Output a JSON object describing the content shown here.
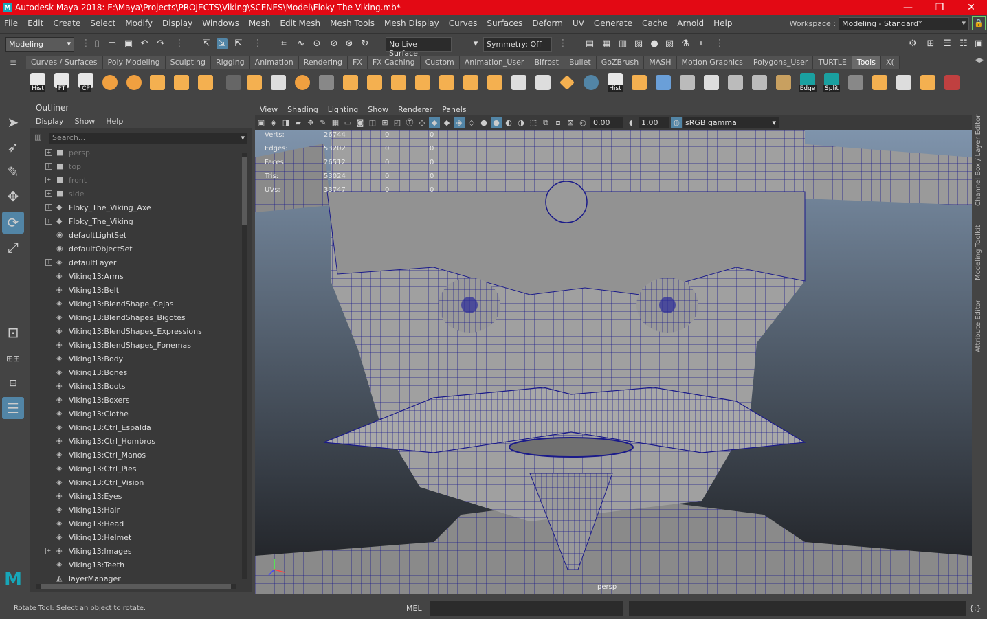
{
  "window": {
    "title": "Autodesk Maya 2018: E:\\Maya\\Projects\\PROJECTS\\Viking\\SCENES\\Model\\Floky The Viking.mb*",
    "logo_letter": "M"
  },
  "menubar": [
    "File",
    "Edit",
    "Create",
    "Select",
    "Modify",
    "Display",
    "Windows",
    "Mesh",
    "Edit Mesh",
    "Mesh Tools",
    "Mesh Display",
    "Curves",
    "Surfaces",
    "Deform",
    "UV",
    "Generate",
    "Cache",
    "Arnold",
    "Help"
  ],
  "workspace": {
    "label": "Workspace :",
    "value": "Modeling - Standard*"
  },
  "statusline": {
    "mode": "Modeling",
    "live_surface": "No Live Surface",
    "symmetry": "Symmetry: Off"
  },
  "shelf_tabs": [
    "Curves / Surfaces",
    "Poly Modeling",
    "Sculpting",
    "Rigging",
    "Animation",
    "Rendering",
    "FX",
    "FX Caching",
    "Custom",
    "Animation_User",
    "Bifrost",
    "Bullet",
    "GoZBrush",
    "MASH",
    "Motion Graphics",
    "Polygons_User",
    "TURTLE",
    "Tools",
    "X("
  ],
  "shelf_active": "Tools",
  "shelf_labels": {
    "hist": "Hist",
    "ft": "FT",
    "cp": "CP",
    "hist2": "Hist",
    "edge": "Edge",
    "split": "Split"
  },
  "outliner": {
    "title": "Outliner",
    "menu": [
      "Display",
      "Show",
      "Help"
    ],
    "search_placeholder": "Search...",
    "items": [
      {
        "label": "persp",
        "icon": "camera-icon",
        "expand": true,
        "dim": true
      },
      {
        "label": "top",
        "icon": "camera-icon",
        "expand": true,
        "dim": true
      },
      {
        "label": "front",
        "icon": "camera-icon",
        "expand": true,
        "dim": true
      },
      {
        "label": "side",
        "icon": "camera-icon",
        "expand": true,
        "dim": true
      },
      {
        "label": "Floky_The_Viking_Axe",
        "icon": "transform-icon",
        "expand": true,
        "dim": false
      },
      {
        "label": "Floky_The_Viking",
        "icon": "transform-icon",
        "expand": true,
        "dim": false
      },
      {
        "label": "defaultLightSet",
        "icon": "set-icon",
        "expand": false,
        "dim": false
      },
      {
        "label": "defaultObjectSet",
        "icon": "set-icon",
        "expand": false,
        "dim": false
      },
      {
        "label": "defaultLayer",
        "icon": "layer-icon",
        "expand": true,
        "dim": false
      },
      {
        "label": "Viking13:Arms",
        "icon": "layer-icon",
        "expand": false,
        "dim": false
      },
      {
        "label": "Viking13:Belt",
        "icon": "layer-icon",
        "expand": false,
        "dim": false
      },
      {
        "label": "Viking13:BlendShape_Cejas",
        "icon": "layer-icon",
        "expand": false,
        "dim": false
      },
      {
        "label": "Viking13:BlendShapes_Bigotes",
        "icon": "layer-icon",
        "expand": false,
        "dim": false
      },
      {
        "label": "Viking13:BlendShapes_Expressions",
        "icon": "layer-icon",
        "expand": false,
        "dim": false
      },
      {
        "label": "Viking13:BlendShapes_Fonemas",
        "icon": "layer-icon",
        "expand": false,
        "dim": false
      },
      {
        "label": "Viking13:Body",
        "icon": "layer-icon",
        "expand": false,
        "dim": false
      },
      {
        "label": "Viking13:Bones",
        "icon": "layer-icon",
        "expand": false,
        "dim": false
      },
      {
        "label": "Viking13:Boots",
        "icon": "layer-icon",
        "expand": false,
        "dim": false
      },
      {
        "label": "Viking13:Boxers",
        "icon": "layer-icon",
        "expand": false,
        "dim": false
      },
      {
        "label": "Viking13:Clothe",
        "icon": "layer-icon",
        "expand": false,
        "dim": false
      },
      {
        "label": "Viking13:Ctrl_Espalda",
        "icon": "layer-icon",
        "expand": false,
        "dim": false
      },
      {
        "label": "Viking13:Ctrl_Hombros",
        "icon": "layer-icon",
        "expand": false,
        "dim": false
      },
      {
        "label": "Viking13:Ctrl_Manos",
        "icon": "layer-icon",
        "expand": false,
        "dim": false
      },
      {
        "label": "Viking13:Ctrl_Pies",
        "icon": "layer-icon",
        "expand": false,
        "dim": false
      },
      {
        "label": "Viking13:Ctrl_Vision",
        "icon": "layer-icon",
        "expand": false,
        "dim": false
      },
      {
        "label": "Viking13:Eyes",
        "icon": "layer-icon",
        "expand": false,
        "dim": false
      },
      {
        "label": "Viking13:Hair",
        "icon": "layer-icon",
        "expand": false,
        "dim": false
      },
      {
        "label": "Viking13:Head",
        "icon": "layer-icon",
        "expand": false,
        "dim": false
      },
      {
        "label": "Viking13:Helmet",
        "icon": "layer-icon",
        "expand": false,
        "dim": false
      },
      {
        "label": "Viking13:Images",
        "icon": "layer-icon",
        "expand": true,
        "dim": false
      },
      {
        "label": "Viking13:Teeth",
        "icon": "layer-icon",
        "expand": false,
        "dim": false
      },
      {
        "label": "layerManager",
        "icon": "layer-manager-icon",
        "expand": false,
        "dim": false
      }
    ]
  },
  "viewport": {
    "menu": [
      "View",
      "Shading",
      "Lighting",
      "Show",
      "Renderer",
      "Panels"
    ],
    "exposure": "0.00",
    "gamma": "1.00",
    "color_space": "sRGB gamma",
    "camera": "persp",
    "hud": [
      {
        "label": "Verts:",
        "value": "26744",
        "s1": "0",
        "s2": "0"
      },
      {
        "label": "Edges:",
        "value": "53202",
        "s1": "0",
        "s2": "0"
      },
      {
        "label": "Faces:",
        "value": "26512",
        "s1": "0",
        "s2": "0"
      },
      {
        "label": "Tris:",
        "value": "53024",
        "s1": "0",
        "s2": "0"
      },
      {
        "label": "UVs:",
        "value": "33747",
        "s1": "0",
        "s2": "0"
      }
    ]
  },
  "right_tabs": [
    "Channel Box / Layer Editor",
    "Modeling Toolkit",
    "Attribute Editor"
  ],
  "helpline": {
    "message": "Rotate Tool: Select an object to rotate.",
    "lang": "MEL"
  },
  "colors": {
    "title_bar": "#e30914",
    "accent": "#5285a6",
    "wire": "#1a1a8a",
    "mesh": "#9a9a9a"
  }
}
